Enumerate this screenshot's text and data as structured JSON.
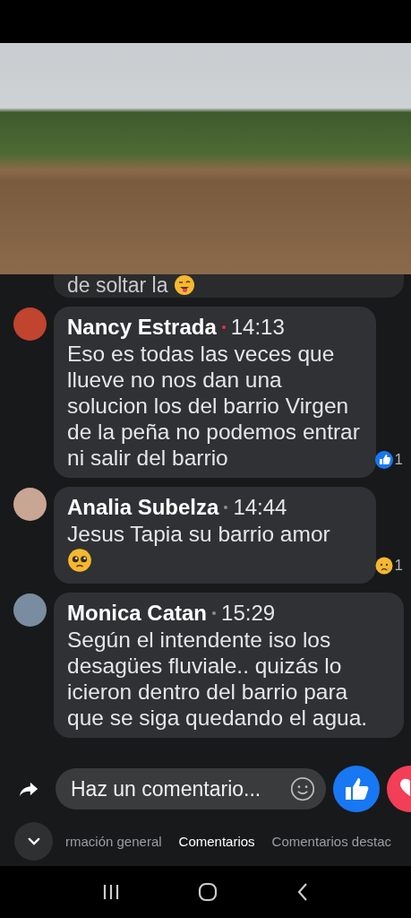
{
  "previous_comment": {
    "text": "de soltar la",
    "emoji": {
      "kind": "winking-tongue"
    }
  },
  "comments": [
    {
      "author": "Nancy Estrada",
      "time": "14:13",
      "new": true,
      "text": "Eso es todas las veces que llueve no nos dan una solucion los del barrio Virgen de la peña no podemos entrar ni salir del barrio",
      "reaction": {
        "kind": "like",
        "count": "1"
      }
    },
    {
      "author": "Analia Subelza",
      "time": "14:44",
      "new": false,
      "text": "Jesus Tapia su barrio amor",
      "emoji": {
        "kind": "pleading"
      },
      "reaction": {
        "kind": "sad",
        "count": "1"
      }
    },
    {
      "author": "Monica Catan",
      "time": "15:29",
      "new": false,
      "text": "Según el intendente iso los desagües fluviale.. quizás lo icieron dentro del barrio para que se siga quedando el agua."
    }
  ],
  "composer": {
    "placeholder": "Haz un comentario..."
  },
  "tabs": [
    {
      "label": "rmación general",
      "selected": false
    },
    {
      "label": "Comentarios",
      "selected": true
    },
    {
      "label": "Comentarios destac",
      "selected": false
    }
  ]
}
